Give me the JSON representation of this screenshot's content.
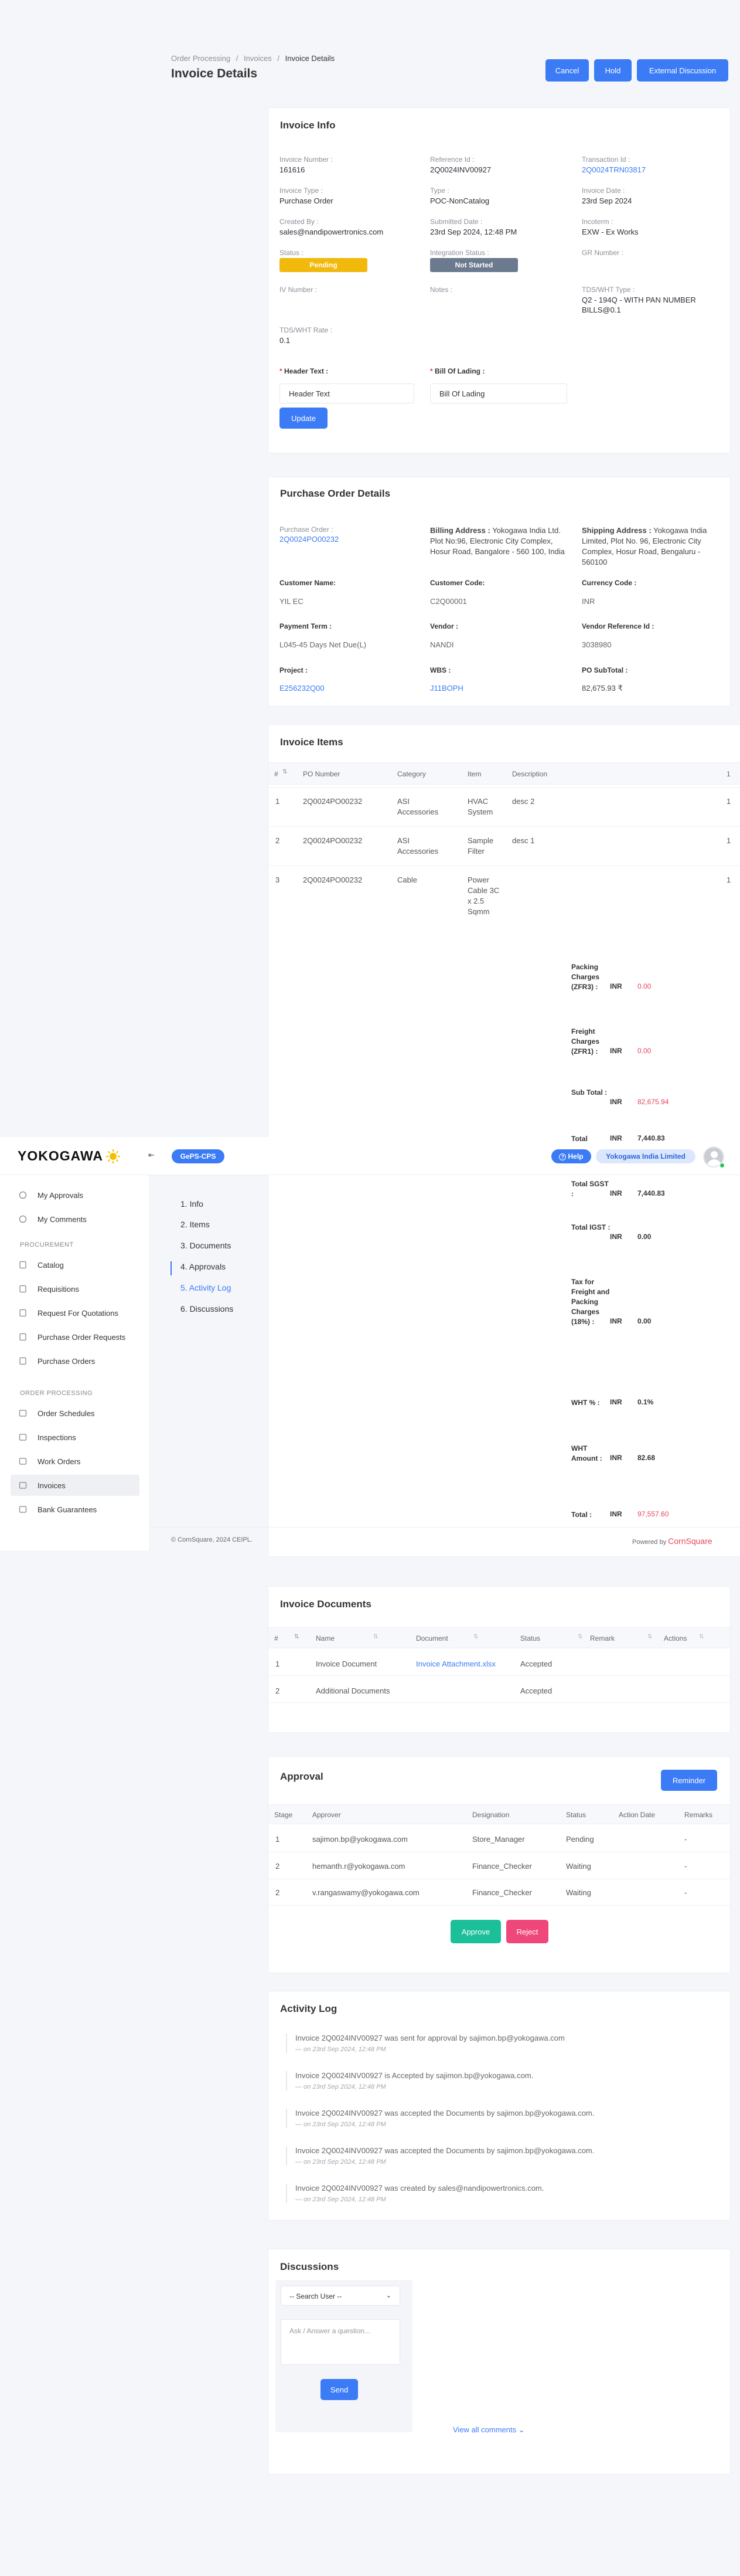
{
  "brand": {
    "logo_text": "YOKOGAWA",
    "app_badge": "GePS-CPS",
    "help_label": "Help",
    "company": "Yokogawa India Limited"
  },
  "breadcrumb": {
    "items": [
      "Order Processing",
      "Invoices",
      "Invoice Details"
    ],
    "sep": "/"
  },
  "page": {
    "title": "Invoice Details"
  },
  "actions": {
    "cancel": "Cancel",
    "hold": "Hold",
    "external": "External Discussion"
  },
  "sidebar": {
    "top": [
      "My Approvals",
      "My Comments"
    ],
    "procurement_label": "PROCUREMENT",
    "procurement": [
      "Catalog",
      "Requisitions",
      "Request For Quotations",
      "Purchase Order Requests",
      "Purchase Orders"
    ],
    "order_label": "ORDER PROCESSING",
    "order": [
      "Order Schedules",
      "Inspections",
      "Work Orders",
      "Invoices",
      "Bank Guarantees"
    ]
  },
  "section_nav": [
    "1. Info",
    "2. Items",
    "3. Documents",
    "4. Approvals",
    "5. Activity Log",
    "6. Discussions"
  ],
  "info": {
    "title": "Invoice Info",
    "fields": [
      {
        "label": "Invoice Number :",
        "value": "161616"
      },
      {
        "label": "Reference Id :",
        "value": "2Q0024INV00927"
      },
      {
        "label": "Transaction Id :",
        "value": "2Q0024TRN03817"
      },
      {
        "label": "Invoice Type :",
        "value": "Purchase Order"
      },
      {
        "label": "Type :",
        "value": "POC-NonCatalog"
      },
      {
        "label": "Invoice Date :",
        "value": "23rd Sep 2024"
      },
      {
        "label": "Created By :",
        "value": "sales@nandipowertronics.com"
      },
      {
        "label": "Submitted Date :",
        "value": "23rd Sep 2024, 12:48 PM"
      },
      {
        "label": "Incoterm :",
        "value": "EXW - Ex Works"
      },
      {
        "label": "Status :",
        "value": "Pending"
      },
      {
        "label": "Integration Status :",
        "value": "Not Started"
      },
      {
        "label": "GR Number :",
        "value": ""
      },
      {
        "label": "IV Number :",
        "value": ""
      },
      {
        "label": "Notes :",
        "value": ""
      },
      {
        "label": "TDS/WHT Type :",
        "value": "Q2 - 194Q - WITH PAN NUMBER BILLS@0.1"
      },
      {
        "label": "TDS/WHT Rate :",
        "value": "0.1"
      }
    ],
    "header_text_label": "Header Text :",
    "header_text_value": "Header Text",
    "bol_label": "Bill Of Lading :",
    "bol_value": "Bill Of Lading",
    "update": "Update"
  },
  "po": {
    "title": "Purchase Order Details",
    "po_label": "Purchase Order :",
    "po_value": "2Q0024PO00232",
    "billing_label": "Billing Address :",
    "billing_value": "Yokogawa India Ltd. Plot No:96, Electronic City Complex, Hosur Road, Bangalore - 560 100, India",
    "shipping_label": "Shipping Address :",
    "shipping_value": "Yokogawa India Limited, Plot No. 96, Electronic City Complex, Hosur Road, Bengaluru - 560100",
    "customer_name_label": "Customer Name:",
    "customer_name": "YIL EC",
    "customer_code_label": "Customer Code:",
    "customer_code": "C2Q00001",
    "currency_label": "Currency Code :",
    "currency": "INR",
    "payment_label": "Payment Term :",
    "payment": "L045-45 Days Net Due(L)",
    "vendor_label": "Vendor :",
    "vendor": "NANDI",
    "vendor_ref_label": "Vendor Reference Id :",
    "vendor_ref": "3038980",
    "project_label": "Project :",
    "project": "E256232Q00",
    "wbs_label": "WBS :",
    "wbs": "J11BOPH",
    "subtotal_label": "PO SubTotal :",
    "subtotal": "82,675.93 ₹"
  },
  "items": {
    "title": "Invoice Items",
    "headers": [
      "#",
      "PO Number",
      "Category",
      "Item",
      "Description"
    ],
    "rows": [
      {
        "n": "1",
        "po": "2Q0024PO00232",
        "cat": "ASI Accessories",
        "item": "HVAC System",
        "desc": "desc 2"
      },
      {
        "n": "2",
        "po": "2Q0024PO00232",
        "cat": "ASI Accessories",
        "item": "Sample Filter",
        "desc": "desc 1"
      },
      {
        "n": "3",
        "po": "2Q0024PO00232",
        "cat": "Cable",
        "item": "Power Cable 3C x 2.5 Sqmm",
        "desc": ""
      }
    ],
    "trailing_col": "1",
    "summary": [
      {
        "label": "Packing Charges (ZFR3) :",
        "cur": "INR",
        "value": "0.00"
      },
      {
        "label": "Freight Charges (ZFR1) :",
        "cur": "INR",
        "value": "0.00"
      },
      {
        "label": "Sub Total :",
        "cur": "INR",
        "value": "82,675.94"
      },
      {
        "label": "Total",
        "cur": "INR",
        "value": "7,440.83"
      },
      {
        "label": "Total SGST :",
        "cur": "INR",
        "value": "7,440.83"
      },
      {
        "label": "Total IGST :",
        "cur": "INR",
        "value": "0.00"
      },
      {
        "label": "Tax for Freight and Packing Charges (18%) :",
        "cur": "INR",
        "value": "0.00"
      },
      {
        "label": "WHT % :",
        "cur": "INR",
        "value": "0.1%"
      },
      {
        "label": "WHT Amount :",
        "cur": "INR",
        "value": "82.68"
      },
      {
        "label": "Total :",
        "cur": "INR",
        "value": "97,557.60"
      }
    ]
  },
  "footer": {
    "copyright": "© CornSquare, 2024 CEIPL.",
    "powered_by": "Powered by",
    "powered_brand": "CornSquare"
  },
  "documents": {
    "title": "Invoice Documents",
    "headers": [
      "#",
      "Name",
      "Document",
      "Status",
      "Remark",
      "Actions"
    ],
    "rows": [
      {
        "n": "1",
        "name": "Invoice Document",
        "doc": "Invoice Attachment.xlsx",
        "status": "Accepted"
      },
      {
        "n": "2",
        "name": "Additional Documents",
        "doc": "",
        "status": "Accepted"
      }
    ]
  },
  "approval": {
    "title": "Approval",
    "reminder": "Reminder",
    "headers": [
      "Stage",
      "Approver",
      "Designation",
      "Status",
      "Action Date",
      "Remarks"
    ],
    "rows": [
      {
        "stage": "1",
        "approver": "sajimon.bp@yokogawa.com",
        "designation": "Store_Manager",
        "status": "Pending",
        "remarks": "-"
      },
      {
        "stage": "2",
        "approver": "hemanth.r@yokogawa.com",
        "designation": "Finance_Checker",
        "status": "Waiting",
        "remarks": "-"
      },
      {
        "stage": "2",
        "approver": "v.rangaswamy@yokogawa.com",
        "designation": "Finance_Checker",
        "status": "Waiting",
        "remarks": "-"
      }
    ],
    "approve": "Approve",
    "reject": "Reject"
  },
  "activity": {
    "title": "Activity Log",
    "entries": [
      {
        "text": "Invoice 2Q0024INV00927 was sent for approval by sajimon.bp@yokogawa.com",
        "date": "— on 23rd Sep 2024, 12:48 PM"
      },
      {
        "text": "Invoice 2Q0024INV00927 is Accepted by sajimon.bp@yokogawa.com.",
        "date": "— on 23rd Sep 2024, 12:48 PM"
      },
      {
        "text": "Invoice 2Q0024INV00927 was accepted the Documents by sajimon.bp@yokogawa.com.",
        "date": "— on 23rd Sep 2024, 12:48 PM"
      },
      {
        "text": "Invoice 2Q0024INV00927 was accepted the Documents by sajimon.bp@yokogawa.com.",
        "date": "— on 23rd Sep 2024, 12:48 PM"
      },
      {
        "text": "Invoice 2Q0024INV00927 was created by sales@nandipowertronics.com.",
        "date": "— on 23rd Sep 2024, 12:48 PM"
      }
    ]
  },
  "discussions": {
    "title": "Discussions",
    "search_user": "-- Search User --",
    "placeholder": "Ask / Answer a question...",
    "send": "Send",
    "view_all": "View all comments"
  },
  "colors": {
    "primary": "#3b7bf6",
    "pending": "#f0b90b",
    "not_started": "#6b7a8f",
    "approve": "#1bbf9a",
    "reject": "#f0477a",
    "red_value": "#e5485d"
  }
}
